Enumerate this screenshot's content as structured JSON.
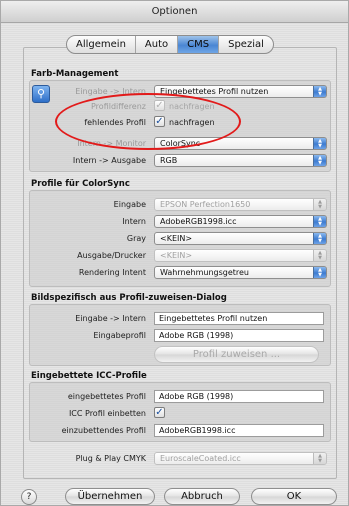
{
  "window": {
    "title": "Optionen"
  },
  "tabs": [
    {
      "label": "Allgemein"
    },
    {
      "label": "Auto"
    },
    {
      "label": "CMS"
    },
    {
      "label": "Spezial"
    }
  ],
  "farb_management": {
    "title": "Farb-Management",
    "eingabe_intern": {
      "label": "Eingabe -> Intern",
      "value": "Eingebettetes Profil nutzen"
    },
    "profildifferenz": {
      "label": "Profildifferenz",
      "check_label": "nachfragen",
      "checked": true
    },
    "fehlendes_profil": {
      "label": "fehlendes Profil",
      "check_label": "nachfragen",
      "checked": true
    },
    "intern_monitor": {
      "label": "Intern -> Monitor",
      "value": "ColorSync"
    },
    "intern_ausgabe": {
      "label": "Intern -> Ausgabe",
      "value": "RGB"
    }
  },
  "profile_colorsync": {
    "title": "Profile für ColorSync",
    "eingabe": {
      "label": "Eingabe",
      "value": "EPSON Perfection1650"
    },
    "intern": {
      "label": "Intern",
      "value": "AdobeRGB1998.icc"
    },
    "gray": {
      "label": "Gray",
      "value": "<KEIN>"
    },
    "ausgabe_drucker": {
      "label": "Ausgabe/Drucker",
      "value": "<KEIN>"
    },
    "rendering_intent": {
      "label": "Rendering Intent",
      "value": "Wahrnehmungsgetreu"
    }
  },
  "bildspezifisch": {
    "title": "Bildspezifisch aus Profil-zuweisen-Dialog",
    "eingabe_intern": {
      "label": "Eingabe -> Intern",
      "value": "Eingebettetes Profil nutzen"
    },
    "eingabeprofil": {
      "label": "Eingabeprofil",
      "value": "Adobe RGB (1998)"
    },
    "assign_button": "Profil zuweisen ..."
  },
  "icc_profile": {
    "title": "Eingebettete ICC-Profile",
    "eingebettetes": {
      "label": "eingebettetes Profil",
      "value": "Adobe RGB (1998)"
    },
    "einbetten": {
      "label": "ICC Profil einbetten",
      "checked": true
    },
    "einzubettendes": {
      "label": "einzubettendes Profil",
      "value": "AdobeRGB1998.icc"
    }
  },
  "plug_play": {
    "label": "Plug & Play CMYK",
    "value": "EuroscaleCoated.icc"
  },
  "footer": {
    "help": "?",
    "apply": "Übernehmen",
    "cancel": "Abbruch",
    "ok": "OK"
  },
  "colors": {
    "accent": "#4a86d3",
    "annotation": "#e21a1a"
  }
}
